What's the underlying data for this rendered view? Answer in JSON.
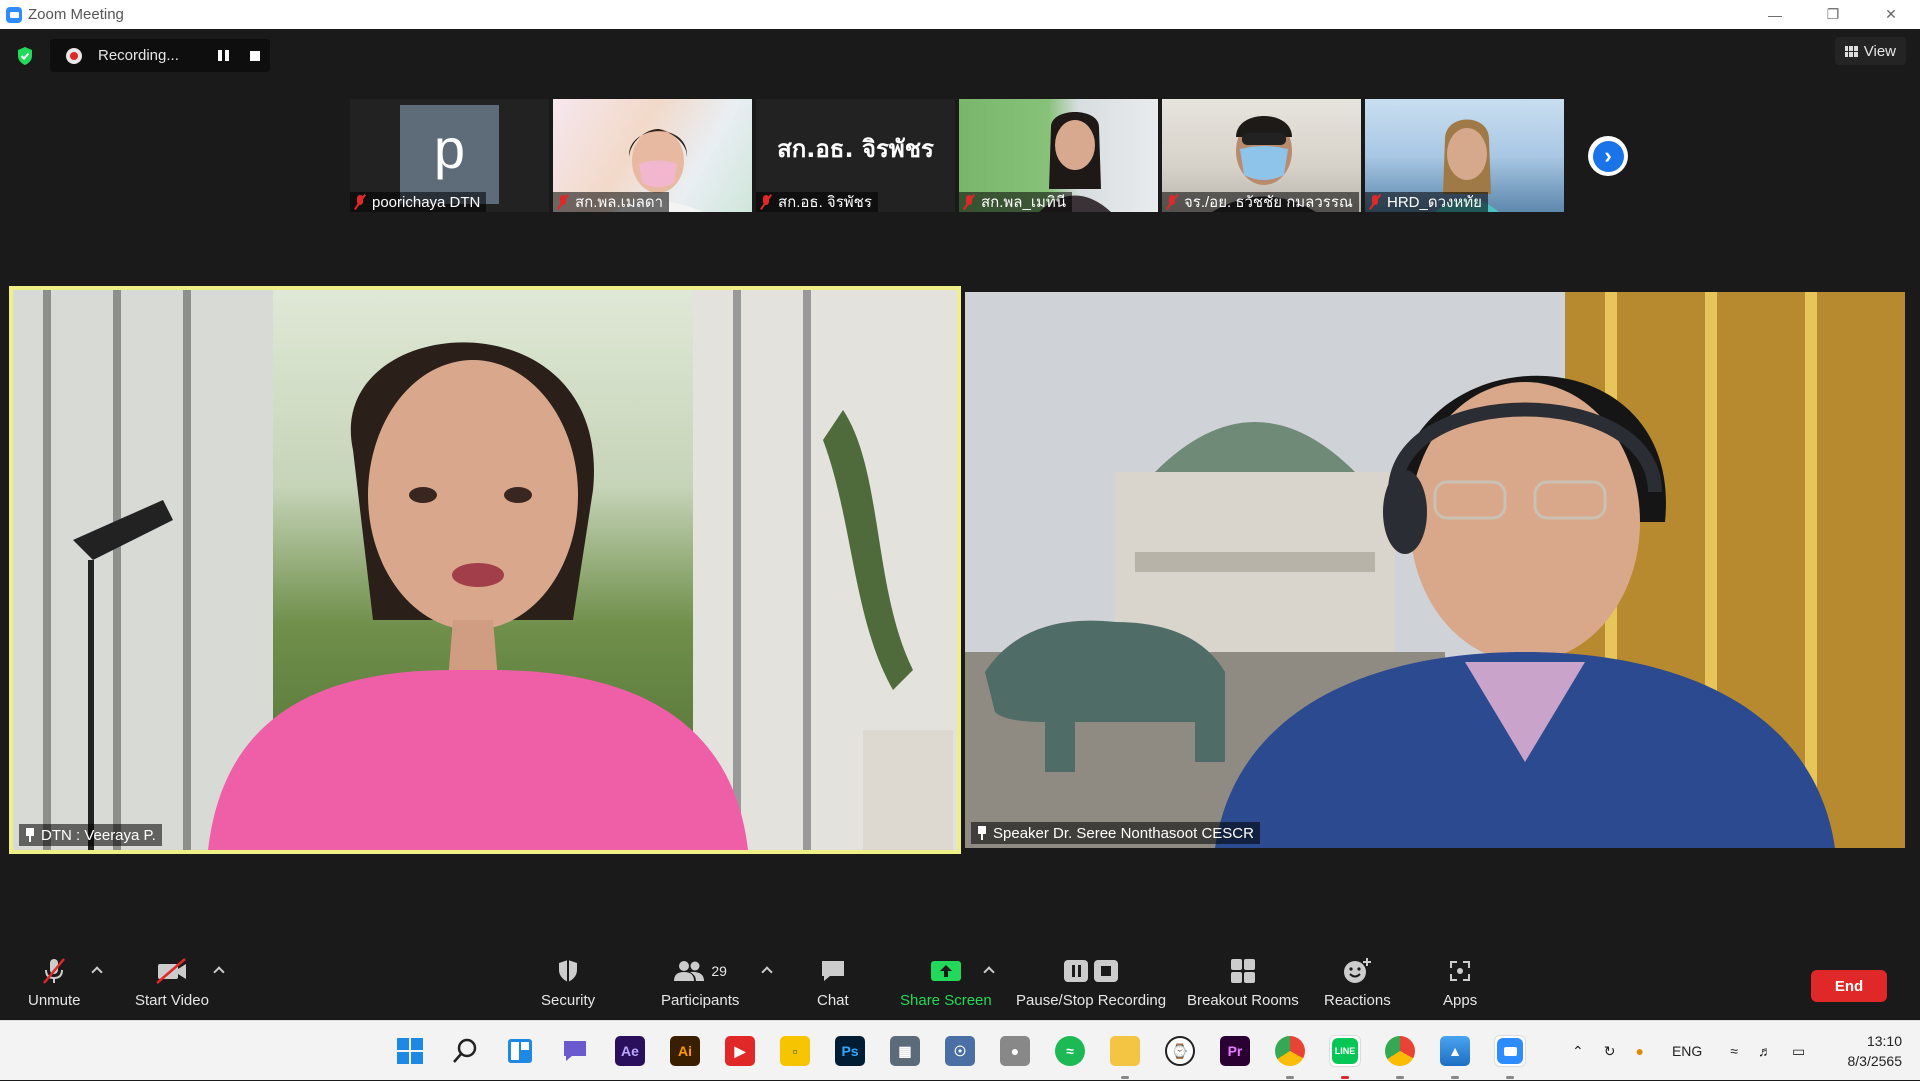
{
  "window": {
    "title": "Zoom Meeting"
  },
  "recording": {
    "label": "Recording..."
  },
  "view": {
    "label": "View"
  },
  "thumbnails": [
    {
      "name": "poorichaya DTN",
      "avatar_letter": "p"
    },
    {
      "name": "สก.พล.เมลดา"
    },
    {
      "name": "สก.อธ. จิรพัชร",
      "display_text": "สก.อธ. จิรพัชร"
    },
    {
      "name": "สก.พล_เมทินี"
    },
    {
      "name": "จร./อย. ธวัชชัย กมลวรรณ"
    },
    {
      "name": "HRD_ดวงหทัย"
    }
  ],
  "videos": [
    {
      "name": "DTN : Veeraya P."
    },
    {
      "name": "Speaker Dr. Seree Nonthasoot CESCR"
    }
  ],
  "toolbar": {
    "unmute": "Unmute",
    "start_video": "Start Video",
    "security": "Security",
    "participants": "Participants",
    "participants_count": "29",
    "chat": "Chat",
    "share_screen": "Share Screen",
    "pause_stop_recording": "Pause/Stop Recording",
    "breakout_rooms": "Breakout Rooms",
    "reactions": "Reactions",
    "apps": "Apps",
    "end": "End"
  },
  "taskbar": {
    "apps": [
      "Start",
      "Search",
      "Widgets",
      "Teams",
      "Ae",
      "Ai",
      "YouTube",
      "Sticky",
      "Ps",
      "Calculator",
      "Security",
      "Microphone",
      "Spotify",
      "File Explorer",
      "Clock",
      "Pr",
      "Chrome",
      "LINE",
      "Chrome Profile",
      "Photos",
      "Zoom"
    ],
    "language": "ENG",
    "time": "13:10",
    "date": "8/3/2565"
  },
  "colors": {
    "accent_green": "#23d959",
    "end_red": "#e02828",
    "active_speaker": "#f0ef86"
  }
}
